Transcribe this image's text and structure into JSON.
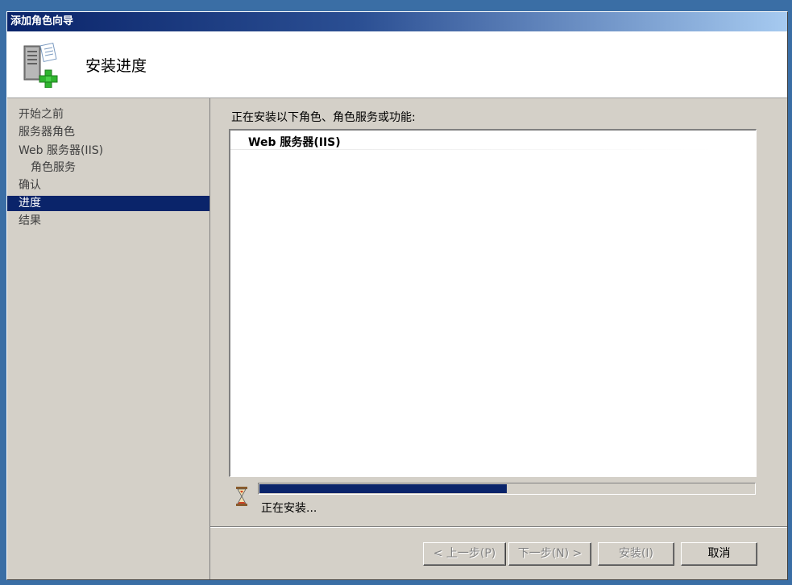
{
  "window": {
    "title": "添加角色向导",
    "page_title": "安装进度"
  },
  "nav": {
    "items": [
      {
        "label": "开始之前",
        "state": "done"
      },
      {
        "label": "服务器角色",
        "state": "done"
      },
      {
        "label": "Web 服务器(IIS)",
        "state": "done"
      },
      {
        "label": "角色服务",
        "state": "done"
      },
      {
        "label": "确认",
        "state": "done"
      },
      {
        "label": "进度",
        "state": "active"
      },
      {
        "label": "结果",
        "state": "pending"
      }
    ]
  },
  "content": {
    "label": "正在安装以下角色、角色服务或功能:",
    "list_items": [
      "Web 服务器(IIS)"
    ],
    "progress_percent": 50,
    "status": "正在安装..."
  },
  "buttons": {
    "prev": "< 上一步(P)",
    "next": "下一步(N) >",
    "install": "安装(I)",
    "cancel": "取消"
  },
  "colors": {
    "titlebar_start": "#0a246a",
    "selection": "#0a246a",
    "face": "#d4d0c8"
  }
}
